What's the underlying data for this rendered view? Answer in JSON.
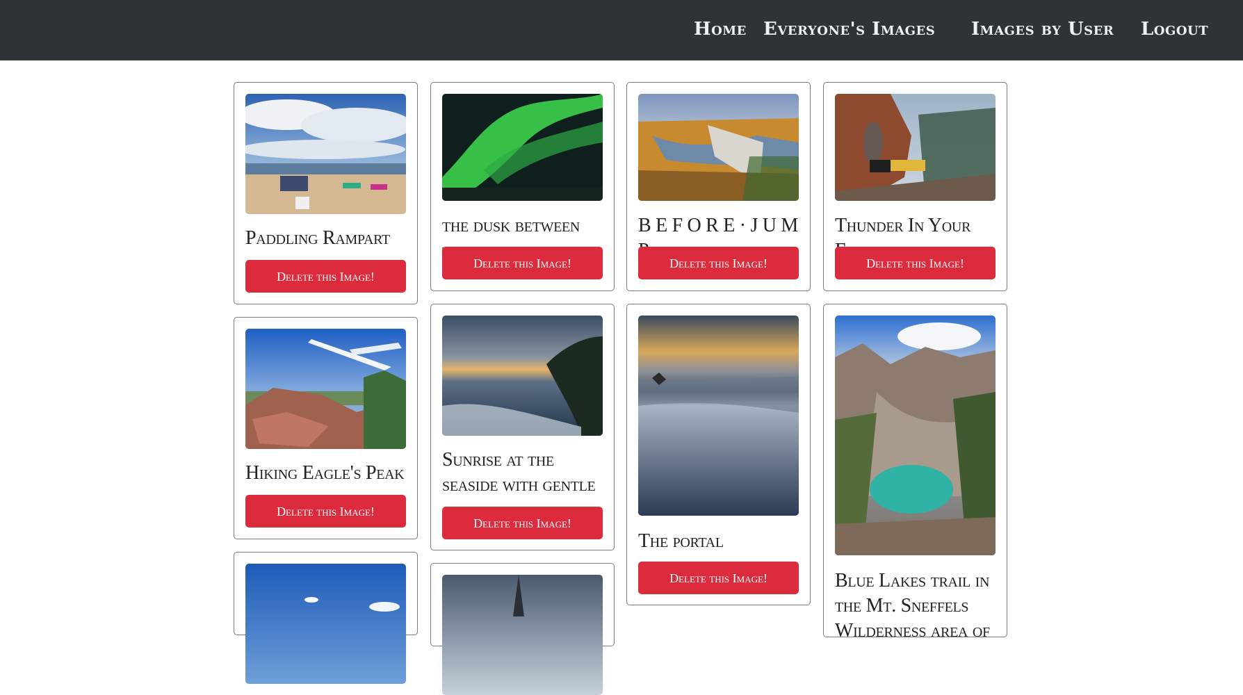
{
  "nav": {
    "home": "Home",
    "everyone": "Everyone's Images",
    "by_user": "Images by User",
    "logout": "Logout"
  },
  "delete_label": "Delete this Image!",
  "cards": [
    {
      "title": "Paddling Rampart"
    },
    {
      "title": "the dusk between the stars"
    },
    {
      "title": "B E F O R E · J U M P"
    },
    {
      "title": "Thunder In Your Ear..."
    },
    {
      "title": "Hiking Eagle's Peak"
    },
    {
      "title": "Sunrise at the seaside with gentle surf and clouds"
    },
    {
      "title": "The portal"
    },
    {
      "title": "Blue Lakes trail in the Mt. Sneffels Wilderness area of"
    }
  ],
  "colors": {
    "navbar": "#2e3338",
    "delete_button": "#dc2b3c"
  }
}
